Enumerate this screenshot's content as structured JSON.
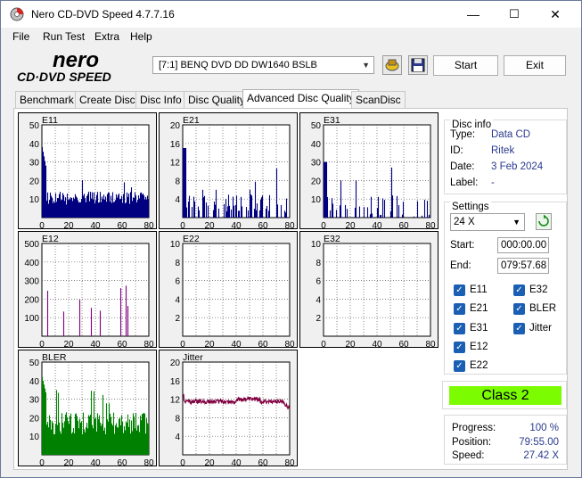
{
  "window": {
    "title": "Nero CD-DVD Speed 4.7.7.16",
    "minimize": "—",
    "maximize": "☐",
    "close": "✕"
  },
  "menu": [
    "File",
    "Run Test",
    "Extra",
    "Help"
  ],
  "logo": {
    "top": "nero",
    "bottom": "CD·DVD SPEED"
  },
  "toolbar": {
    "drive": "[7:1]  BENQ DVD DD DW1640 BSLB",
    "start": "Start",
    "exit": "Exit"
  },
  "tabs": [
    "Benchmark",
    "Create Disc",
    "Disc Info",
    "Disc Quality",
    "Advanced Disc Quality",
    "ScanDisc"
  ],
  "active_tab": 4,
  "charts": [
    {
      "name": "E11",
      "ymax": 50,
      "yticks": [
        50,
        40,
        30,
        20,
        10
      ],
      "color": "#000080",
      "style": "bars",
      "profile": "e11"
    },
    {
      "name": "E21",
      "ymax": 20,
      "yticks": [
        20,
        16,
        12,
        8,
        4
      ],
      "color": "#000080",
      "style": "bars",
      "profile": "e21"
    },
    {
      "name": "E31",
      "ymax": 50,
      "yticks": [
        50,
        40,
        30,
        20,
        10
      ],
      "color": "#000080",
      "style": "bars",
      "profile": "e31"
    },
    {
      "name": "E12",
      "ymax": 500,
      "yticks": [
        500,
        400,
        300,
        200,
        100
      ],
      "color": "#800080",
      "style": "bars",
      "profile": "e12"
    },
    {
      "name": "E22",
      "ymax": 10,
      "yticks": [
        10,
        8,
        6,
        4,
        2
      ],
      "color": "#800080",
      "style": "bars",
      "profile": "none"
    },
    {
      "name": "E32",
      "ymax": 10,
      "yticks": [
        10,
        8,
        6,
        4,
        2
      ],
      "color": "#800080",
      "style": "bars",
      "profile": "none"
    },
    {
      "name": "BLER",
      "ymax": 50,
      "yticks": [
        50,
        40,
        30,
        20,
        10
      ],
      "color": "#008000",
      "style": "bars",
      "profile": "bler"
    },
    {
      "name": "Jitter",
      "ymax": 20,
      "yticks": [
        20,
        16,
        12,
        8,
        4
      ],
      "color": "#800040",
      "style": "line",
      "profile": "jitter"
    }
  ],
  "xticks": [
    0,
    20,
    40,
    60,
    80
  ],
  "disc_info": {
    "title": "Disc info",
    "type_label": "Type:",
    "type": "Data CD",
    "id_label": "ID:",
    "id": "Ritek",
    "date_label": "Date:",
    "date": "3 Feb 2024",
    "label_label": "Label:",
    "label": "-"
  },
  "settings": {
    "title": "Settings",
    "speed": "24 X",
    "start_label": "Start:",
    "start": "000:00.00",
    "end_label": "End:",
    "end": "079:57.68",
    "checks": [
      "E11",
      "E32",
      "E21",
      "BLER",
      "E31",
      "Jitter",
      "E12",
      "E22"
    ]
  },
  "class": "Class 2",
  "progress": {
    "progress_label": "Progress:",
    "progress": "100 %",
    "position_label": "Position:",
    "position": "79:55.00",
    "speed_label": "Speed:",
    "speed": "27.42 X"
  },
  "colors": {
    "class_bg": "#7cfc00",
    "accent": "#1a5fb4"
  }
}
